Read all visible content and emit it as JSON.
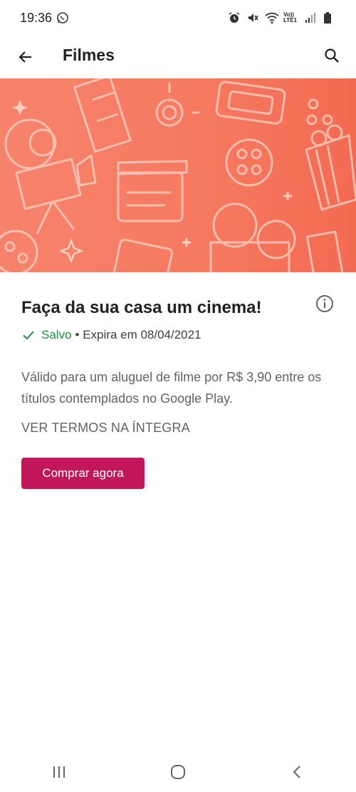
{
  "status_bar": {
    "time": "19:36",
    "icons": [
      "whatsapp-icon",
      "alarm-icon",
      "mute-icon",
      "wifi-icon",
      "volte-icon",
      "signal-icon",
      "battery-icon"
    ],
    "volte_label": "Vo)) LTE1"
  },
  "app_bar": {
    "title": "Filmes",
    "back_icon": "arrow-back-icon",
    "search_icon": "search-icon"
  },
  "banner": {
    "colors": {
      "start": "#f6836c",
      "end": "#f36a52",
      "line": "#ffffff"
    },
    "icons": [
      "film-strip-icon",
      "movie-camera-icon",
      "clapperboard-icon",
      "ticket-icon",
      "film-reel-icon",
      "popcorn-icon",
      "sparkle-icon"
    ]
  },
  "offer": {
    "title": "Faça da sua casa um cinema!",
    "saved_label": "Salvo",
    "expiry_text": "• Expira em 08/04/2021",
    "description": "Válido para um aluguel de filme por R$ 3,90 entre os títulos contemplados no Google Play.",
    "terms_link": "VER TERMOS NA ÍNTEGRA",
    "buy_button": "Comprar agora",
    "info_icon": "info-icon"
  },
  "nav_bar": {
    "recents_icon": "recents-icon",
    "home_icon": "home-icon",
    "back_icon": "back-chevron-icon"
  },
  "colors": {
    "accent": "#c2185b",
    "saved_green": "#1e8e3e",
    "text_primary": "#202124",
    "text_secondary": "#5f6368"
  }
}
